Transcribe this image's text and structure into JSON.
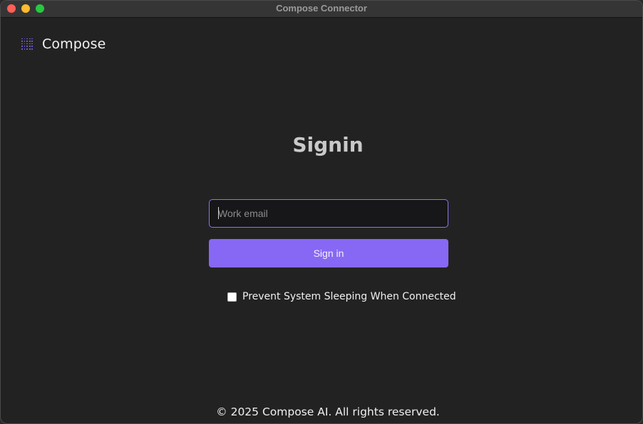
{
  "window": {
    "title": "Compose Connector"
  },
  "brand": {
    "name": "Compose",
    "icon": "dot-grid-logo-icon",
    "accent_color": "#7c63e6"
  },
  "signin": {
    "heading": "Signin",
    "email_placeholder": "Work email",
    "email_value": "",
    "button_label": "Sign in",
    "button_color": "#8768f4",
    "prevent_sleep_label": "Prevent System Sleeping When Connected",
    "prevent_sleep_checked": false
  },
  "footer": {
    "copyright": "© 2025 Compose AI. All rights reserved."
  }
}
